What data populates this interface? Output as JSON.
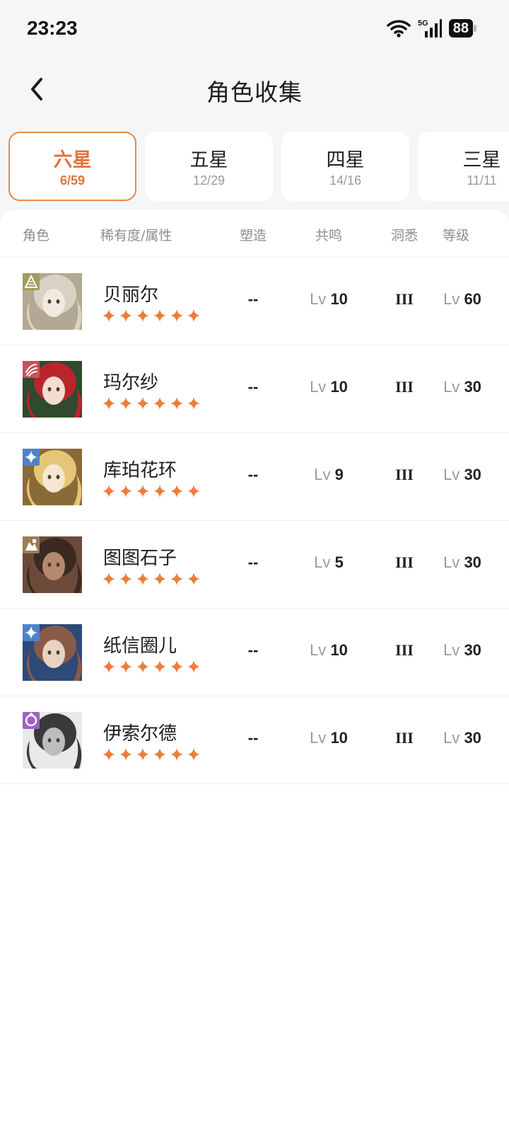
{
  "status": {
    "time": "23:23",
    "network": "5G",
    "battery": "88"
  },
  "header": {
    "title": "角色收集"
  },
  "tabs": [
    {
      "label": "六星",
      "count": "6/59"
    },
    {
      "label": "五星",
      "count": "12/29"
    },
    {
      "label": "四星",
      "count": "14/16"
    },
    {
      "label": "三星",
      "count": "11/11"
    }
  ],
  "columns": {
    "character": "角色",
    "rarity_attr": "稀有度/属性",
    "forge": "塑造",
    "resonance": "共鸣",
    "insight": "洞悉",
    "level": "等级"
  },
  "lv_prefix": "Lv",
  "characters": [
    {
      "name": "贝丽尔",
      "stars": 6,
      "forge": "--",
      "resonance": "10",
      "insight": "III",
      "level": "60",
      "element_icon": "plant-icon",
      "element_color": "#a39b5e"
    },
    {
      "name": "玛尔纱",
      "stars": 6,
      "forge": "--",
      "resonance": "10",
      "insight": "III",
      "level": "30",
      "element_icon": "beast-icon",
      "element_color": "#c4535a"
    },
    {
      "name": "库珀花环",
      "stars": 6,
      "forge": "--",
      "resonance": "9",
      "insight": "III",
      "level": "30",
      "element_icon": "star-icon",
      "element_color": "#4d83cc"
    },
    {
      "name": "图图石子",
      "stars": 6,
      "forge": "--",
      "resonance": "5",
      "insight": "III",
      "level": "30",
      "element_icon": "mineral-icon",
      "element_color": "#9c7c52"
    },
    {
      "name": "纸信圈儿",
      "stars": 6,
      "forge": "--",
      "resonance": "10",
      "insight": "III",
      "level": "30",
      "element_icon": "star-icon",
      "element_color": "#4d83cc"
    },
    {
      "name": "伊索尔德",
      "stars": 6,
      "forge": "--",
      "resonance": "10",
      "insight": "III",
      "level": "30",
      "element_icon": "spirit-icon",
      "element_color": "#a062c2"
    }
  ],
  "colors": {
    "accent": "#e2733a",
    "star": "#ee7c3a"
  }
}
